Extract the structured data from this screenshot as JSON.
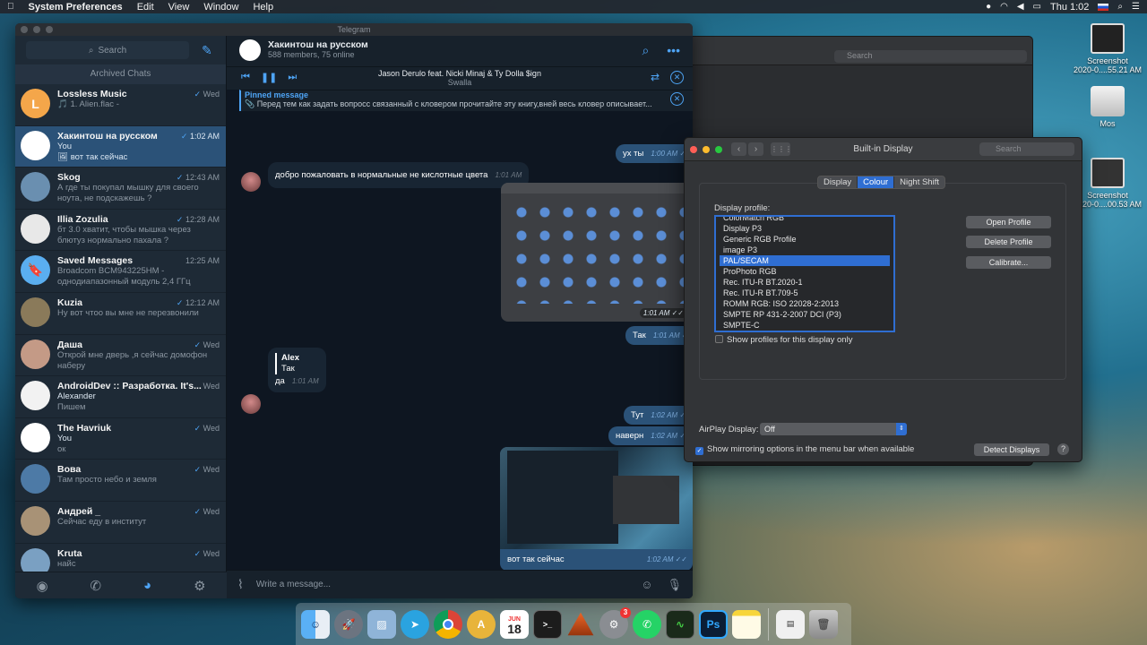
{
  "menubar": {
    "app": "System Preferences",
    "items": [
      "Edit",
      "View",
      "Window",
      "Help"
    ],
    "clock": "Thu 1:02"
  },
  "desktop": {
    "icons": [
      {
        "line1": "Screenshot",
        "line2": "2020-0....55.21 AM"
      },
      {
        "line1": "Mos",
        "line2": ""
      },
      {
        "line1": "Screenshot",
        "line2": "2020-0....00.53 AM"
      }
    ]
  },
  "back_window": {
    "search_placeholder": "Search"
  },
  "telegram": {
    "window_title": "Telegram",
    "search_label": "Search",
    "archived_label": "Archived Chats",
    "chats": [
      {
        "name": "Lossless Music",
        "sender": "",
        "msg": "🎵 1. Alien.flac -",
        "time": "Wed",
        "color": "#f4a64a",
        "letter": "L",
        "check": true
      },
      {
        "name": "Хакинтош на русском",
        "sender": "You",
        "msg": "🖼 вот так сейчас",
        "time": "1:02 AM",
        "color": "#ffffff",
        "letter": "",
        "check": true
      },
      {
        "name": "Skog",
        "sender": "",
        "msg": "А где ты покупал мышку для своего ноута, не подскажешь ?",
        "time": "12:43 AM",
        "color": "#6a8fb0",
        "letter": "",
        "check": true
      },
      {
        "name": "Illia Zozulia",
        "sender": "",
        "msg": "бт 3.0 хватит, чтобы мышка через блютуз нормально пахала ?",
        "time": "12:28 AM",
        "color": "#e8e8e8",
        "letter": "",
        "check": true
      },
      {
        "name": "Saved Messages",
        "sender": "",
        "msg": "Broadcom BCM943225HM - однодиапазонный модуль 2,4 ГГц Broad...",
        "time": "12:25 AM",
        "color": "#5aaef0",
        "letter": "🔖",
        "check": false
      },
      {
        "name": "Kuzia",
        "sender": "",
        "msg": "Ну вот чтоо вы мне не перезвонили",
        "time": "12:12 AM",
        "color": "#8a7a5a",
        "letter": "",
        "check": true
      },
      {
        "name": "Даша",
        "sender": "",
        "msg": "Открой мне дверь ,я сейчас домофон наберу",
        "time": "Wed",
        "color": "#c49a86",
        "letter": "",
        "check": true
      },
      {
        "name": "AndroidDev :: Разработка. It's...",
        "sender": "Alexander",
        "msg": "Пишем",
        "time": "Wed",
        "color": "#f2f2f2",
        "letter": "",
        "check": false
      },
      {
        "name": "The Havriuk",
        "sender": "You",
        "msg": "ок",
        "time": "Wed",
        "color": "#ffffff",
        "letter": "",
        "check": true
      },
      {
        "name": "Вова",
        "sender": "",
        "msg": "Там просто небо и земля",
        "time": "Wed",
        "color": "#4d7aa6",
        "letter": "",
        "check": true
      },
      {
        "name": "Андрей _",
        "sender": "",
        "msg": "Сейчас еду в институт",
        "time": "Wed",
        "color": "#a89276",
        "letter": "",
        "check": true
      },
      {
        "name": "Kruta",
        "sender": "",
        "msg": "найс",
        "time": "Wed",
        "color": "#7aa0c2",
        "letter": "",
        "check": true
      }
    ],
    "header": {
      "title": "Хакинтош на русском",
      "subtitle": "588 members, 75 online"
    },
    "player": {
      "track": "Jason Derulo feat. Nicki Minaj & Ty Dolla $ign",
      "artist": "Swalla"
    },
    "pinned": {
      "title": "Pinned message",
      "text": "📎 Перед тем как задать вопросс связанный с кловером прочитайте эту книгу,вней весь кловер описывает..."
    },
    "messages": {
      "m1": {
        "text": "ух ты",
        "time": "1:00 AM ✓✓"
      },
      "m2": {
        "text": "добро пожаловать в нормальные не кислотные цвета",
        "time": "1:01 AM"
      },
      "m3": {
        "time": "1:01 AM ✓✓"
      },
      "m4": {
        "text": "Так",
        "time": "1:01 AM ✓✓"
      },
      "m5": {
        "reply_name": "Alex",
        "reply_text": "Так",
        "text": "да",
        "time": "1:01 AM"
      },
      "m6": {
        "text": "Тут",
        "time": "1:02 AM ✓✓"
      },
      "m7": {
        "text": "наверн",
        "time": "1:02 AM ✓✓"
      },
      "m8": {
        "caption": "вот так сейчас",
        "time": "1:02 AM ✓✓"
      }
    },
    "composer_placeholder": "Write a message..."
  },
  "display_window": {
    "title": "Built-in Display",
    "search_placeholder": "Search",
    "tabs": [
      "Display",
      "Colour",
      "Night Shift"
    ],
    "profile_label": "Display profile:",
    "profiles": [
      "ColorMatch RGB",
      "Display P3",
      "Generic RGB Profile",
      "image P3",
      "PAL/SECAM",
      "ProPhoto RGB",
      "Rec. ITU-R BT.2020-1",
      "Rec. ITU-R BT.709-5",
      "ROMM RGB: ISO 22028-2:2013",
      "SMPTE RP 431-2-2007 DCI (P3)",
      "SMPTE-C"
    ],
    "selected_profile": "PAL/SECAM",
    "buttons": {
      "open": "Open Profile",
      "delete": "Delete Profile",
      "calibrate": "Calibrate..."
    },
    "show_profiles_label": "Show profiles for this display only",
    "airplay_label": "AirPlay Display:",
    "airplay_value": "Off",
    "mirroring_label": "Show mirroring options in the menu bar when available",
    "detect_button": "Detect Displays"
  },
  "dock": {
    "calendar_month": "JUN",
    "calendar_day": "18",
    "badge": "3"
  },
  "colors": {
    "accent": "#4ea4f5",
    "tg_bg": "#17212b",
    "tg_active": "#2b5278",
    "mac_select": "#2f6ed2"
  }
}
